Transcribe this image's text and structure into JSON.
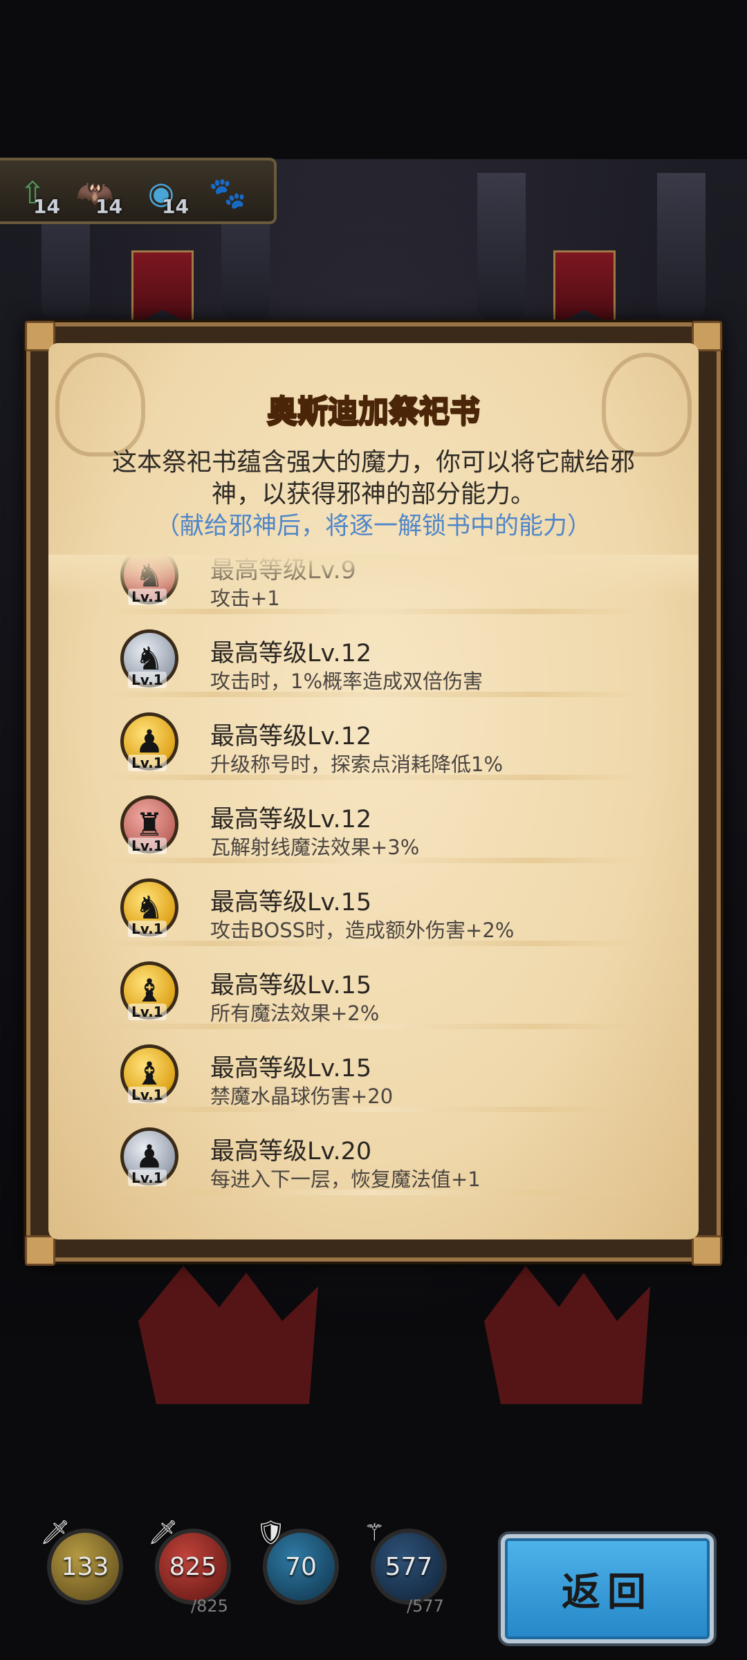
{
  "stats": [
    {
      "icon": "up-arrow-icon",
      "glyph": "⇧",
      "value": "14"
    },
    {
      "icon": "bat-icon",
      "glyph": "🦇",
      "value": "14"
    },
    {
      "icon": "slime-icon",
      "glyph": "◉",
      "value": "14"
    },
    {
      "icon": "paw-icon",
      "glyph": "🐾",
      "value": ""
    }
  ],
  "book": {
    "title": "奥斯迪加祭祀书",
    "description": "这本祭祀书蕴含强大的魔力，你可以将它献给邪神，以获得邪神的部分能力。",
    "hint": "（献给邪神后，将逐一解锁书中的能力）"
  },
  "abilities": [
    {
      "badge": "red",
      "piece": "knight",
      "glyph": "♞",
      "lv": "Lv.1",
      "level": "最高等级Lv.9",
      "effect": "攻击+1"
    },
    {
      "badge": "silver",
      "piece": "knight",
      "glyph": "♞",
      "lv": "Lv.1",
      "level": "最高等级Lv.12",
      "effect": "攻击时，1%概率造成双倍伤害"
    },
    {
      "badge": "gold",
      "piece": "pawn",
      "glyph": "♟",
      "lv": "Lv.1",
      "level": "最高等级Lv.12",
      "effect": "升级称号时，探索点消耗降低1%"
    },
    {
      "badge": "red",
      "piece": "rook",
      "glyph": "♜",
      "lv": "Lv.1",
      "level": "最高等级Lv.12",
      "effect": "瓦解射线魔法效果+3%"
    },
    {
      "badge": "gold",
      "piece": "knight",
      "glyph": "♞",
      "lv": "Lv.1",
      "level": "最高等级Lv.15",
      "effect": "攻击BOSS时，造成额外伤害+2%"
    },
    {
      "badge": "gold",
      "piece": "bishop",
      "glyph": "♝",
      "lv": "Lv.1",
      "level": "最高等级Lv.15",
      "effect": "所有魔法效果+2%"
    },
    {
      "badge": "gold",
      "piece": "bishop",
      "glyph": "♝",
      "lv": "Lv.1",
      "level": "最高等级Lv.15",
      "effect": "禁魔水晶球伤害+20"
    },
    {
      "badge": "silver",
      "piece": "pawn",
      "glyph": "♟",
      "lv": "Lv.1",
      "level": "最高等级Lv.20",
      "effect": "每进入下一层，恢复魔法值+1"
    }
  ],
  "hud": {
    "attack": {
      "value": "133",
      "icon": "sword-icon"
    },
    "health": {
      "value": "825",
      "max": "/825",
      "icon": "health-sword-icon"
    },
    "defense": {
      "value": "70",
      "icon": "shield-icon"
    },
    "mana": {
      "value": "577",
      "max": "/577",
      "icon": "staff-icon"
    }
  },
  "back_button": "返回"
}
